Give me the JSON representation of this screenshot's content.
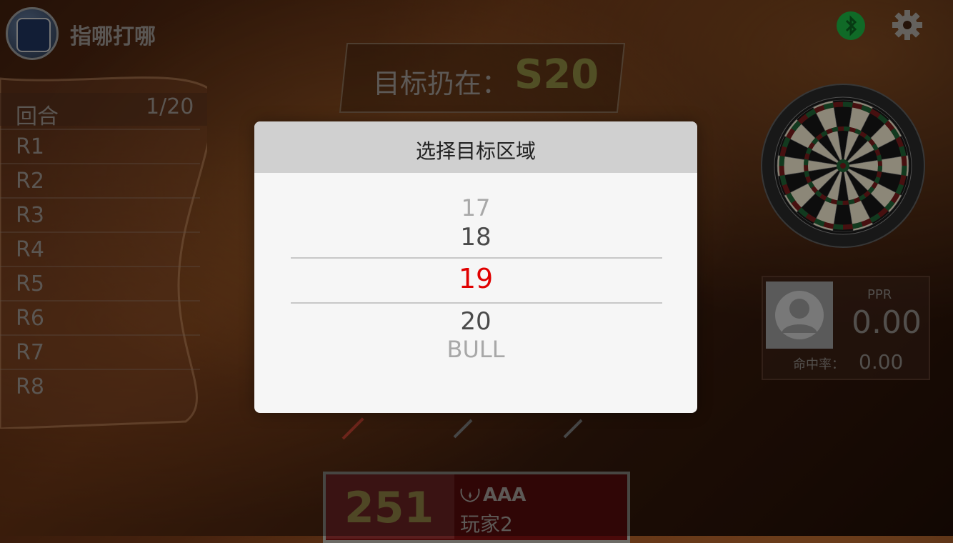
{
  "header": {
    "app_title": "指哪打哪"
  },
  "target": {
    "label": "目标扔在：",
    "value": "S20"
  },
  "rounds": {
    "header_label": "回合",
    "counter": "1/20",
    "items": [
      "R1",
      "R2",
      "R3",
      "R4",
      "R5",
      "R6",
      "R7",
      "R8"
    ]
  },
  "stats": {
    "ppr_label": "PPR",
    "ppr_value": "0.00",
    "hit_label": "命中率：",
    "hit_value": "0.00"
  },
  "player": {
    "score": "251",
    "rank": "AAA",
    "name": "玩家2"
  },
  "modal": {
    "title": "选择目标区域",
    "options": {
      "far_up": "17",
      "near_up": "18",
      "selected": "19",
      "near_down": "20",
      "far_down": "BULL"
    }
  },
  "colors": {
    "selected": "#e00000",
    "bluetooth": "#1aa33c",
    "target_value": "#7d7a3a"
  },
  "icons": [
    "bluetooth-icon",
    "gear-icon",
    "avatar-icon",
    "laurel-icon",
    "dartboard-icon"
  ]
}
